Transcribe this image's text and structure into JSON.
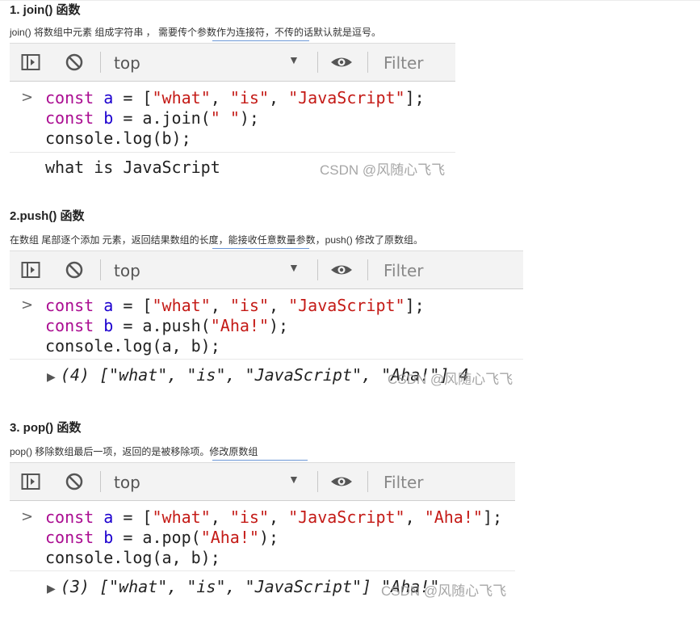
{
  "sections": [
    {
      "heading": "1. join() 函数",
      "description": "join() 将数组中元素 组成字符串 ， 需要传个参数作为连接符，不传的话默认就是逗号。",
      "toolbar": {
        "context": "top",
        "filter_placeholder": "Filter"
      },
      "code": [
        "const a = [\"what\", \"is\", \"JavaScript\"];",
        "const b = a.join(\" \");",
        "console.log(b);"
      ],
      "output": "what is JavaScript",
      "watermark": "CSDN @风随心飞飞"
    },
    {
      "heading": "2.push() 函数",
      "description": "在数组 尾部逐个添加 元素，返回结果数组的长度，能接收任意数量参数，push() 修改了原数组。",
      "toolbar": {
        "context": "top",
        "filter_placeholder": "Filter"
      },
      "code": [
        "const a = [\"what\", \"is\", \"JavaScript\"];",
        "const b = a.push(\"Aha!\");",
        "console.log(a, b);"
      ],
      "output": "(4) [\"what\", \"is\", \"JavaScript\", \"Aha!\"] 4",
      "watermark": "CSDN @风随心飞飞"
    },
    {
      "heading": "3. pop() 函数",
      "description": "pop() 移除数组最后一项，返回的是被移除项。修改原数组",
      "toolbar": {
        "context": "top",
        "filter_placeholder": "Filter"
      },
      "code": [
        "const a = [\"what\", \"is\", \"JavaScript\", \"Aha!\"];",
        "const b = a.pop(\"Aha!\");",
        "console.log(a, b);"
      ],
      "output": "(3) [\"what\", \"is\", \"JavaScript\"] \"Aha!\"",
      "watermark": "CSDN @风随心飞飞"
    }
  ],
  "colors": {
    "keyword": "#aa0d91",
    "string": "#c41a16",
    "number": "#1c00cf",
    "toolbar_bg": "#f3f3f3",
    "link_underline": "#6c97d6"
  },
  "icons": [
    "sidebar-toggle-icon",
    "clear-console-icon",
    "dropdown-arrow-icon",
    "eye-icon",
    "console-prompt-icon",
    "expand-triangle-icon"
  ]
}
